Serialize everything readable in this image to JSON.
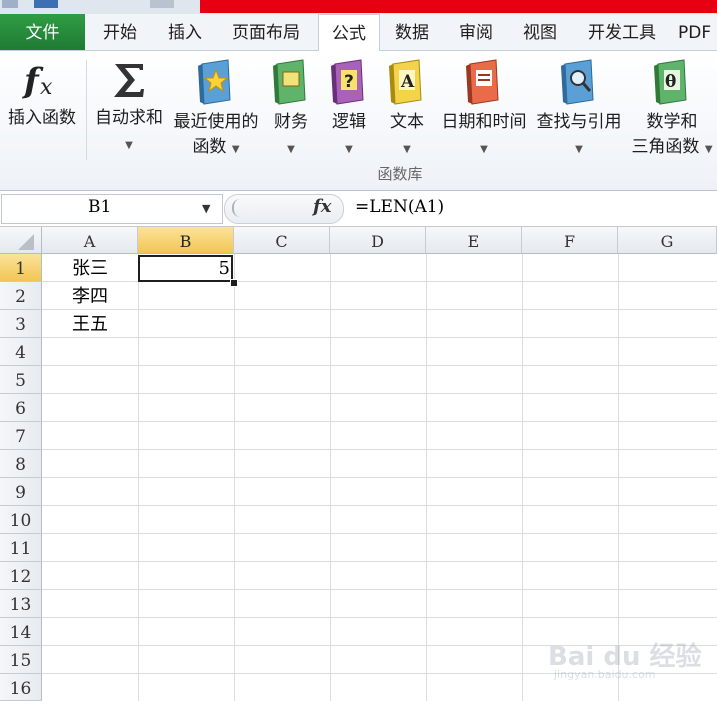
{
  "tabs": {
    "file": "文件",
    "items": [
      "开始",
      "插入",
      "页面布局",
      "公式",
      "数据",
      "审阅",
      "视图",
      "开发工具",
      "PDF"
    ],
    "active": "公式"
  },
  "ribbon": {
    "buttons": [
      {
        "label": "插入函数",
        "icon": "fx-icon"
      },
      {
        "label": "自动求和",
        "icon": "sigma-icon",
        "dropdown": true
      },
      {
        "label": "最近使用的",
        "label2": "函数",
        "icon": "book-star-icon",
        "dropdown": true
      },
      {
        "label": "财务",
        "icon": "book-finance-icon",
        "dropdown": true
      },
      {
        "label": "逻辑",
        "icon": "book-question-icon",
        "dropdown": true
      },
      {
        "label": "文本",
        "icon": "book-text-icon",
        "dropdown": true
      },
      {
        "label": "日期和时间",
        "icon": "book-calendar-icon",
        "dropdown": true
      },
      {
        "label": "查找与引用",
        "icon": "book-search-icon",
        "dropdown": true
      },
      {
        "label": "数学和",
        "label2": "三角函数",
        "icon": "book-theta-icon",
        "dropdown": true
      }
    ],
    "group_label": "函数库"
  },
  "formula_bar": {
    "name_box": "B1",
    "fx": "fx",
    "formula": "=LEN(A1)"
  },
  "sheet": {
    "columns": [
      "A",
      "B",
      "C",
      "D",
      "E",
      "F",
      "G"
    ],
    "rows": [
      "1",
      "2",
      "3",
      "4",
      "5",
      "6",
      "7",
      "8",
      "9",
      "10",
      "11",
      "12",
      "13",
      "14",
      "15",
      "16"
    ],
    "selected_cell": "B1",
    "cells": {
      "A1": "张三",
      "A2": "李四",
      "A3": "王五",
      "B1": "5"
    }
  },
  "colors": {
    "file_tab": "#1f7a33",
    "selected_header": "#f2c555",
    "title_red": "#e60012"
  },
  "watermark": {
    "text": "Bai du 经验",
    "sub": "jingyan.baidu.com"
  }
}
